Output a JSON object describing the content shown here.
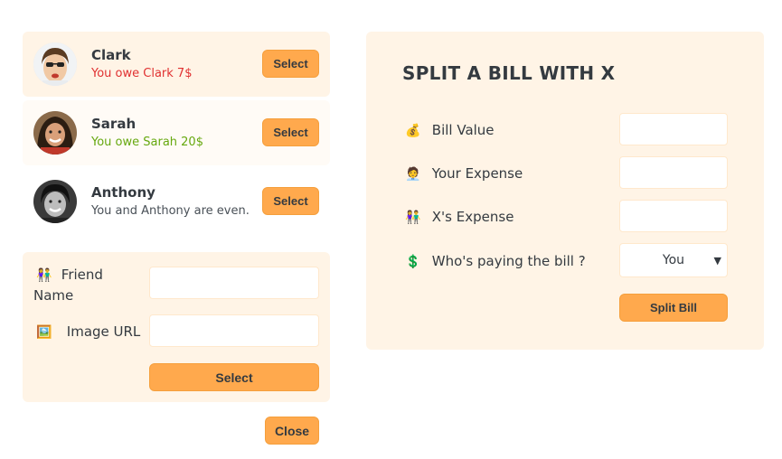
{
  "friends": [
    {
      "name": "Clark",
      "status": "You owe Clark 7$",
      "button": "Select"
    },
    {
      "name": "Sarah",
      "status": "You owe Sarah 20$",
      "button": "Select"
    },
    {
      "name": "Anthony",
      "status": "You and Anthony are even.",
      "button": "Select"
    }
  ],
  "add_friend": {
    "name_icon": "👫",
    "name_label_line1": "Friend",
    "name_label_line2": "Name",
    "image_icon": "🖼️",
    "image_label": "Image URL",
    "submit": "Select",
    "name_value": "",
    "image_value": ""
  },
  "close_button": "Close",
  "split": {
    "title": "SPLIT A BILL WITH X",
    "bill_icon": "💰",
    "bill_label": "Bill Value",
    "your_icon": "🧑‍💼",
    "your_label": "Your Expense",
    "friend_icon": "👫",
    "friend_label": "X's Expense",
    "payer_icon": "💲",
    "payer_label": "Who's paying the bill ?",
    "payer_selected": "You",
    "submit": "Split Bill"
  },
  "colors": {
    "accent": "#ffa94d",
    "panel": "#fff4e6",
    "owe": "#e03131",
    "owed": "#66a80f"
  }
}
